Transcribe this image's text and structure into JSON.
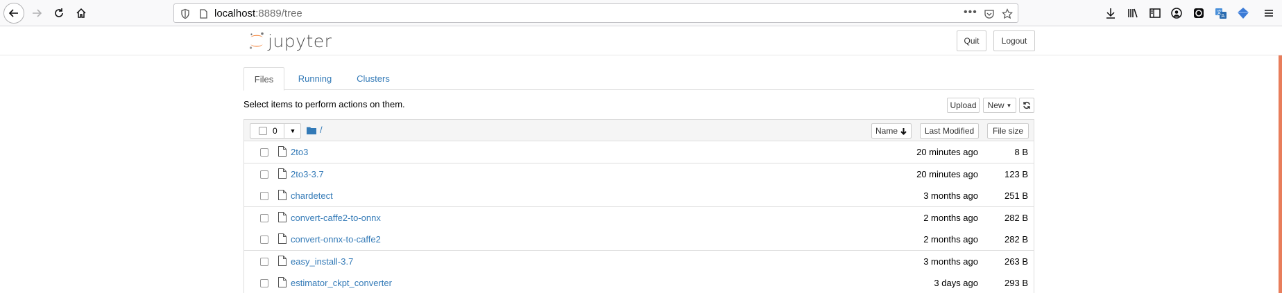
{
  "browser": {
    "url_host": "localhost",
    "url_rest": ":8889/tree",
    "icons": [
      "back-icon",
      "forward-icon",
      "reload-icon",
      "home-icon",
      "shield-icon",
      "page-icon",
      "more-icon",
      "pocket-icon",
      "bookmark-star-icon",
      "download-icon",
      "library-icon",
      "sidebar-icon",
      "account-icon",
      "extension-icon",
      "translate-icon",
      "extension-blue-icon",
      "menu-icon"
    ]
  },
  "header": {
    "logo_text": "jupyter",
    "quit_label": "Quit",
    "logout_label": "Logout"
  },
  "tabs": [
    {
      "label": "Files",
      "active": true
    },
    {
      "label": "Running",
      "active": false
    },
    {
      "label": "Clusters",
      "active": false
    }
  ],
  "toolbar": {
    "instructions": "Select items to perform actions on them.",
    "upload_label": "Upload",
    "new_label": "New"
  },
  "list": {
    "selected_count": "0",
    "breadcrumb": "/",
    "sort_name": "Name",
    "sort_modified": "Last Modified",
    "sort_size": "File size",
    "rows": [
      {
        "name": "2to3",
        "modified": "20 minutes ago",
        "size": "8 B"
      },
      {
        "name": "2to3-3.7",
        "modified": "20 minutes ago",
        "size": "123 B"
      },
      {
        "name": "chardetect",
        "modified": "3 months ago",
        "size": "251 B"
      },
      {
        "name": "convert-caffe2-to-onnx",
        "modified": "2 months ago",
        "size": "282 B"
      },
      {
        "name": "convert-onnx-to-caffe2",
        "modified": "2 months ago",
        "size": "282 B"
      },
      {
        "name": "easy_install-3.7",
        "modified": "3 months ago",
        "size": "263 B"
      },
      {
        "name": "estimator_ckpt_converter",
        "modified": "3 days ago",
        "size": "293 B"
      }
    ]
  },
  "colors": {
    "link": "#337ab7",
    "accent": "#e87d5b",
    "jupyter_orange": "#f37726"
  }
}
